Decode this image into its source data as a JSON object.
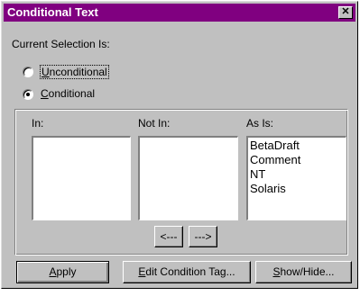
{
  "dialog": {
    "title": "Conditional Text",
    "close_glyph": "✕",
    "current_selection_label": "Current Selection Is:",
    "radio_unconditional": {
      "mnemonic": "U",
      "rest": "nconditional",
      "selected": false
    },
    "radio_conditional": {
      "mnemonic": "C",
      "rest": "onditional",
      "selected": true
    },
    "lists": {
      "in_label": "In:",
      "not_in_label": "Not In:",
      "as_is_label": "As Is:",
      "in_items": [],
      "not_in_items": [],
      "as_is_items": [
        "BetaDraft",
        "Comment",
        "NT",
        "Solaris"
      ]
    },
    "move_left_label": "<---",
    "move_right_label": "--->",
    "buttons": {
      "apply": {
        "mnemonic": "A",
        "rest": "pply"
      },
      "edit": {
        "mnemonic": "E",
        "rest": "dit Condition Tag..."
      },
      "show": {
        "mnemonic": "S",
        "rest": "how/Hide..."
      }
    }
  },
  "colors": {
    "titlebar": "#800080",
    "face": "#c0c0c0",
    "list_bg": "#ffffff"
  },
  "icons": {
    "close": "close-icon",
    "radio": "radio-button"
  }
}
